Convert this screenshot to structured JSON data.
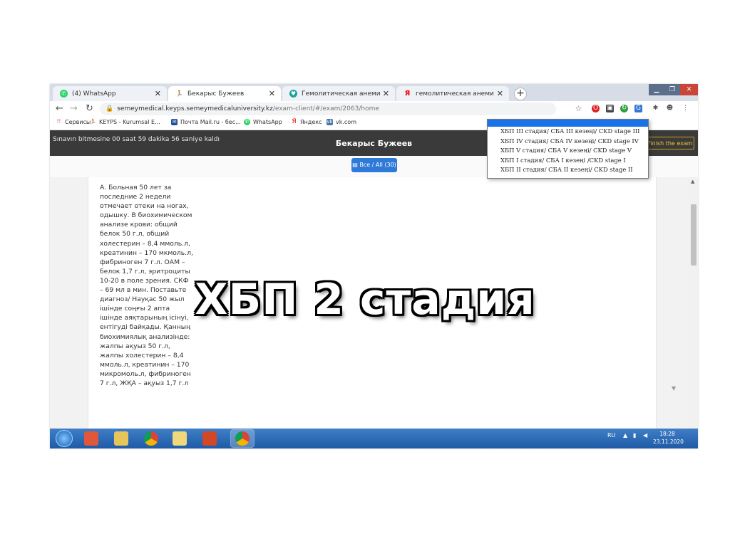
{
  "browser": {
    "tabs": [
      {
        "label": "(4) WhatsApp",
        "icon": "whatsapp-icon"
      },
      {
        "label": "Бекарыс Бужеев",
        "icon": "person-icon"
      },
      {
        "label": "Гемолитическая анемия - при",
        "icon": "heart-icon"
      },
      {
        "label": "гемолитическая анемия — Янд",
        "icon": "yandex-icon"
      }
    ],
    "new_tab": "+",
    "url_host": "semeymedical.keyps.semeymedicaluniversity.kz",
    "url_path": "/exam-client/#/exam/2063/home"
  },
  "bookmarks": [
    {
      "label": "Сервисы",
      "icon": "apps-grid-icon"
    },
    {
      "label": "KEYPS - Kurumsal E...",
      "icon": "person-icon"
    },
    {
      "label": "Почта Mail.ru - бес...",
      "icon": "mail-icon"
    },
    {
      "label": "WhatsApp",
      "icon": "whatsapp-icon"
    },
    {
      "label": "Яндекс",
      "icon": "yandex-icon"
    },
    {
      "label": "vk.com",
      "icon": "vk-icon"
    }
  ],
  "exam": {
    "timer": "Sınavın bitmesine 00 saat 59 dakika 56 saniye kaldı",
    "student": "Бекарыс Бужеев",
    "finish_label": "Finish the exam",
    "all_label": "Все / All (30)"
  },
  "question": {
    "text": "А. Больная 50 лет за последние 2 недели отмечает отеки на ногах, одышку. В биохимическом анализе крови: общий белок 50 г.л, общий холестерин – 8,4 ммоль.л, креатинин – 170 мкмоль.л, фибриноген 7 г.л. ОАМ – белок 1,7 г.л, эритроциты 10-20 в поле зрения. СКФ – 69 мл в мин. Поставьте диагноз/ Науқас 50 жыл ішінде соңғы 2 апта ішінде аяқтарының ісінуі, ентігуді байқады. Қанның биохимиялық анализінде: жалпы ақуыз 50 г.л, жалпы холестерин – 8,4 ммоль.л, креатинин – 170 микромоль.л, фибриноген 7 г.л, ЖҚА – ақуыз 1,7 г.л"
  },
  "dropdown": {
    "options": [
      "ХБП III стадия/ СБА III кезеңі/ CKD stage III",
      "ХБП IV стадия/ СБА IV кезеңі/ CKD stage IV",
      "ХБП V стадия/ СБА V кезеңі/ CKD stage V",
      "ХБП I стадия/ СБА I кезеңі /CKD stage I",
      "ХБП II стадия/ СБА II кезеңі/ CKD stage II"
    ]
  },
  "taskbar": {
    "lang": "RU",
    "time": "18:28",
    "date": "23.11.2020"
  },
  "overlay_text": "ХБП 2 стадия",
  "colors": {
    "exam_header": "#3a3a3a",
    "accent_blue": "#2f7ad8",
    "finish_gold": "#f1c232",
    "taskbar": "#1f5aa6"
  }
}
